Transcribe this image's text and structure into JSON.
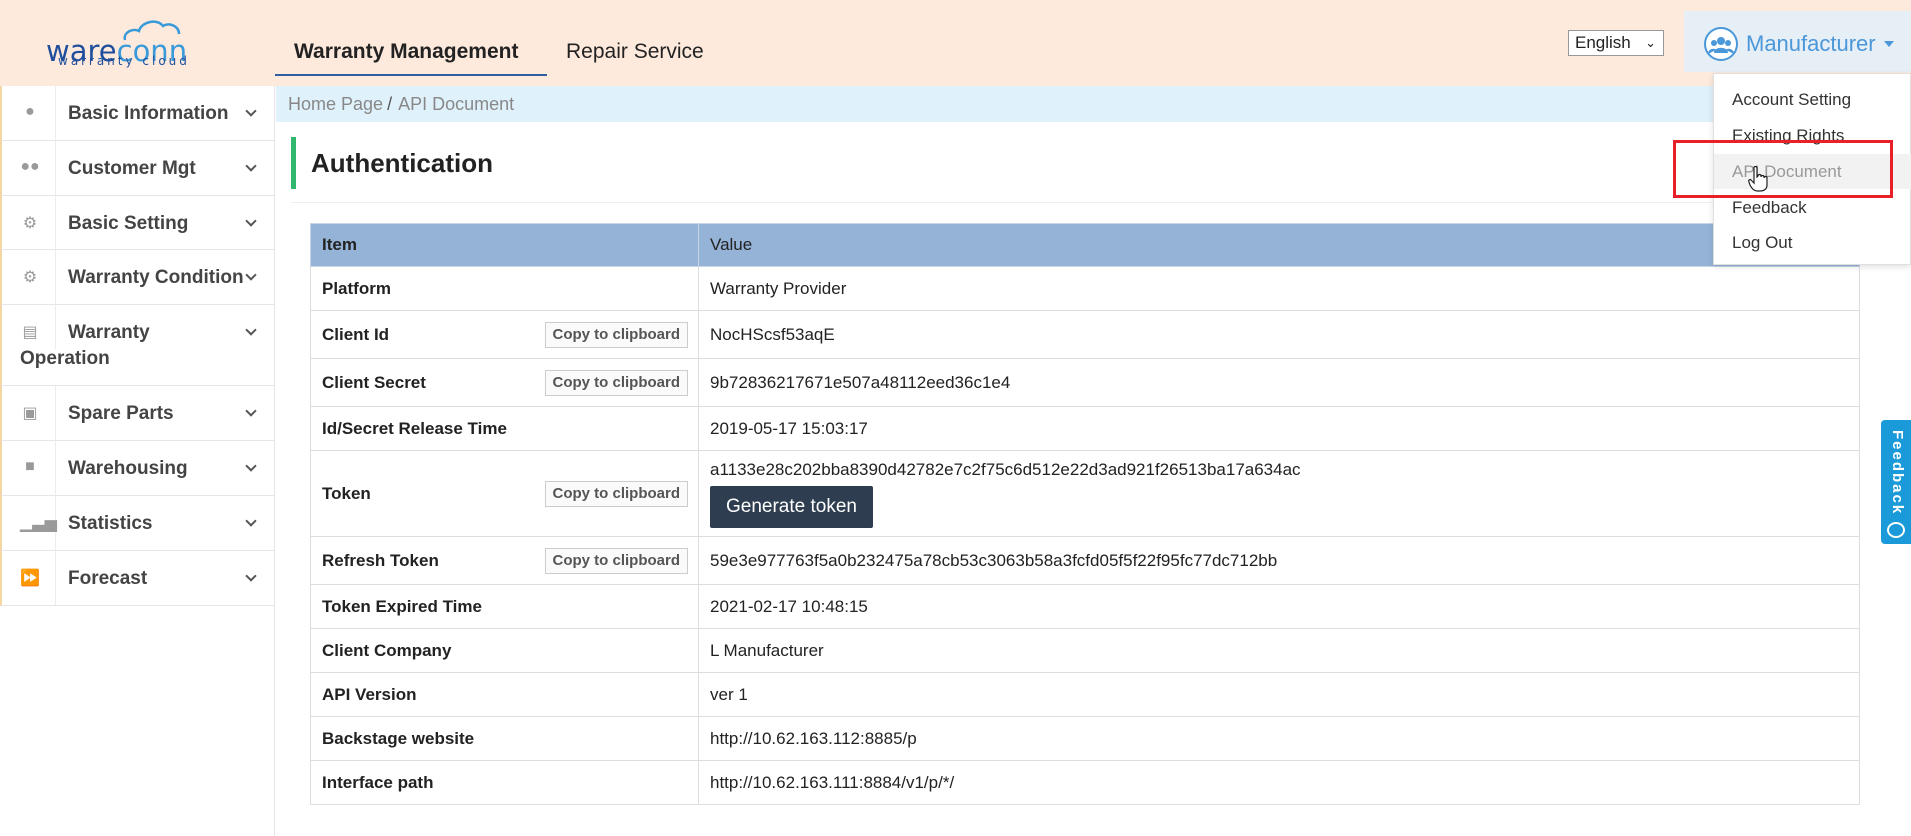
{
  "header": {
    "logo_main_a": "ware",
    "logo_main_b": "conn",
    "logo_sub": "warranty cloud",
    "tabs": [
      {
        "label": "Warranty Management"
      },
      {
        "label": "Repair Service"
      }
    ],
    "language": "English",
    "user_name": "Manufacturer"
  },
  "user_menu": {
    "items": [
      {
        "label": "Account Setting"
      },
      {
        "label": "Existing Rights"
      },
      {
        "label": "API Document"
      },
      {
        "label": "Feedback"
      },
      {
        "label": "Log Out"
      }
    ]
  },
  "sidebar": {
    "items": [
      {
        "label": "Basic Information",
        "icon": "user-icon"
      },
      {
        "label": "Customer Mgt",
        "icon": "users-icon"
      },
      {
        "label": "Basic Setting",
        "icon": "cogs-icon"
      },
      {
        "label": "Warranty Condition",
        "icon": "gear-icon"
      },
      {
        "label": "Warranty",
        "label2": "Operation",
        "icon": "document-icon"
      },
      {
        "label": "Spare Parts",
        "icon": "briefcase-icon"
      },
      {
        "label": "Warehousing",
        "icon": "truck-icon"
      },
      {
        "label": "Statistics",
        "icon": "bar-chart-icon"
      },
      {
        "label": "Forecast",
        "icon": "fast-forward-icon"
      }
    ]
  },
  "breadcrumb": {
    "home": "Home Page",
    "separator": "/",
    "current": "API Document"
  },
  "page": {
    "title": "Authentication"
  },
  "table": {
    "head_item": "Item",
    "head_value": "Value",
    "copy_label": "Copy to clipboard",
    "generate_label": "Generate token",
    "rows": [
      {
        "key": "Platform",
        "value": "Warranty Provider"
      },
      {
        "key": "Client Id",
        "value": "NocHScsf53aqE"
      },
      {
        "key": "Client Secret",
        "value": "9b72836217671e507a48112eed36c1e4"
      },
      {
        "key": "Id/Secret Release Time",
        "value": "2019-05-17 15:03:17"
      },
      {
        "key": "Token",
        "value": "a1133e28c202bba8390d42782e7c2f75c6d512e22d3ad921f26513ba17a634ac"
      },
      {
        "key": "Refresh Token",
        "value": "59e3e977763f5a0b232475a78cb53c3063b58a3fcfd05f5f22f95fc77dc712bb"
      },
      {
        "key": "Token Expired Time",
        "value": "2021-02-17 10:48:15"
      },
      {
        "key": "Client Company",
        "value": "L Manufacturer"
      },
      {
        "key": "API Version",
        "value": "ver 1"
      },
      {
        "key": "Backstage website",
        "value": "http://10.62.163.112:8885/p"
      },
      {
        "key": "Interface path",
        "value": "http://10.62.163.111:8884/v1/p/*/"
      }
    ]
  },
  "feedback_tab": {
    "label": "Feedback"
  },
  "colors": {
    "header_bg": "#fdeadd",
    "accent_blue": "#4a97d9",
    "table_head": "#95b3d7",
    "title_bar": "#2fb86e",
    "highlight": "#e8202a"
  }
}
